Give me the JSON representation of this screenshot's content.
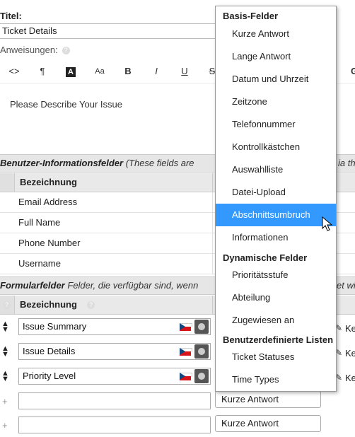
{
  "form": {
    "title_label": "Titel:",
    "title_value": "Ticket Details",
    "instructions_label": "Anweisungen:",
    "editor_text": "Please Describe Your Issue"
  },
  "toolbar": {
    "buttons": [
      "<>",
      "¶",
      "A",
      "Aa",
      "B",
      "I",
      "U",
      "S"
    ],
    "right_char": "G"
  },
  "user_fields": {
    "title": "Benutzer-Informationsfelder",
    "desc": "(These fields are",
    "desc_tail": "ia th",
    "column": "Bezeichnung",
    "rows": [
      "Email Address",
      "Full Name",
      "Phone Number",
      "Username"
    ]
  },
  "form_fields": {
    "title": "Formularfelder",
    "desc": "Felder, die verfügbar sind, wenn",
    "desc_tail": "et wi",
    "column": "Bezeichnung",
    "rows": [
      "Issue Summary",
      "Issue Details",
      "Priority Level"
    ],
    "edit_label": "Ke",
    "new_row_type": "Kurze Antwort"
  },
  "dropdown": {
    "groups": [
      {
        "label": "Basis-Felder",
        "items": [
          "Kurze Antwort",
          "Lange Antwort",
          "Datum und Uhrzeit",
          "Zeitzone",
          "Telefonnummer",
          "Kontrollkästchen",
          "Auswahlliste",
          "Datei-Upload",
          "Abschnittsumbruch",
          "Informationen"
        ]
      },
      {
        "label": "Dynamische Felder",
        "items": [
          "Prioritätsstufe",
          "Abteilung",
          "Zugewiesen an"
        ]
      },
      {
        "label": "Benutzerdefinierte Listen",
        "items": [
          "Ticket Statuses",
          "Time Types"
        ]
      }
    ],
    "selected": "Abschnittsumbruch",
    "selected_color": "#3399ff"
  }
}
